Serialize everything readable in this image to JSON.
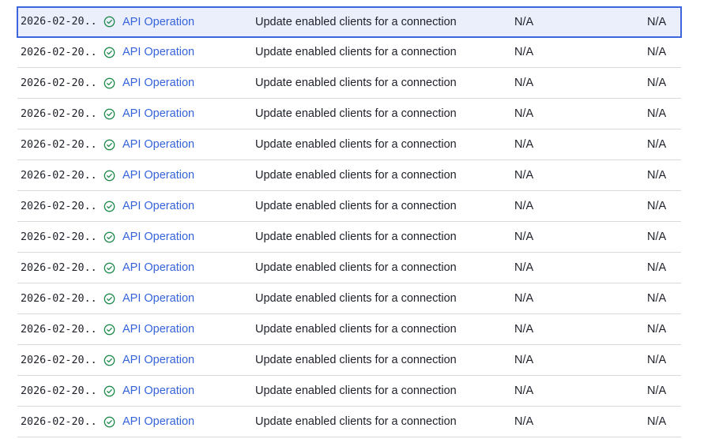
{
  "logs": {
    "rows": [
      {
        "date": "2026-02-20...",
        "type": "API Operation",
        "description": "Update enabled clients for a connection",
        "col4": "N/A",
        "col5": "N/A",
        "selected": true
      },
      {
        "date": "2026-02-20...",
        "type": "API Operation",
        "description": "Update enabled clients for a connection",
        "col4": "N/A",
        "col5": "N/A"
      },
      {
        "date": "2026-02-20...",
        "type": "API Operation",
        "description": "Update enabled clients for a connection",
        "col4": "N/A",
        "col5": "N/A"
      },
      {
        "date": "2026-02-20...",
        "type": "API Operation",
        "description": "Update enabled clients for a connection",
        "col4": "N/A",
        "col5": "N/A"
      },
      {
        "date": "2026-02-20...",
        "type": "API Operation",
        "description": "Update enabled clients for a connection",
        "col4": "N/A",
        "col5": "N/A"
      },
      {
        "date": "2026-02-20...",
        "type": "API Operation",
        "description": "Update enabled clients for a connection",
        "col4": "N/A",
        "col5": "N/A"
      },
      {
        "date": "2026-02-20...",
        "type": "API Operation",
        "description": "Update enabled clients for a connection",
        "col4": "N/A",
        "col5": "N/A"
      },
      {
        "date": "2026-02-20...",
        "type": "API Operation",
        "description": "Update enabled clients for a connection",
        "col4": "N/A",
        "col5": "N/A"
      },
      {
        "date": "2026-02-20...",
        "type": "API Operation",
        "description": "Update enabled clients for a connection",
        "col4": "N/A",
        "col5": "N/A"
      },
      {
        "date": "2026-02-20...",
        "type": "API Operation",
        "description": "Update enabled clients for a connection",
        "col4": "N/A",
        "col5": "N/A"
      },
      {
        "date": "2026-02-20...",
        "type": "API Operation",
        "description": "Update enabled clients for a connection",
        "col4": "N/A",
        "col5": "N/A"
      },
      {
        "date": "2026-02-20...",
        "type": "API Operation",
        "description": "Update enabled clients for a connection",
        "col4": "N/A",
        "col5": "N/A"
      },
      {
        "date": "2026-02-20...",
        "type": "API Operation",
        "description": "Update enabled clients for a connection",
        "col4": "N/A",
        "col5": "N/A"
      },
      {
        "date": "2026-02-20...",
        "type": "API Operation",
        "description": "Update enabled clients for a connection",
        "col4": "N/A",
        "col5": "N/A"
      }
    ],
    "status_icon": "check-circle-icon",
    "colors": {
      "success": "#1f8a4c",
      "link": "#3563d9",
      "selected_border": "#3d66de",
      "selected_bg": "#ebeefb"
    }
  }
}
